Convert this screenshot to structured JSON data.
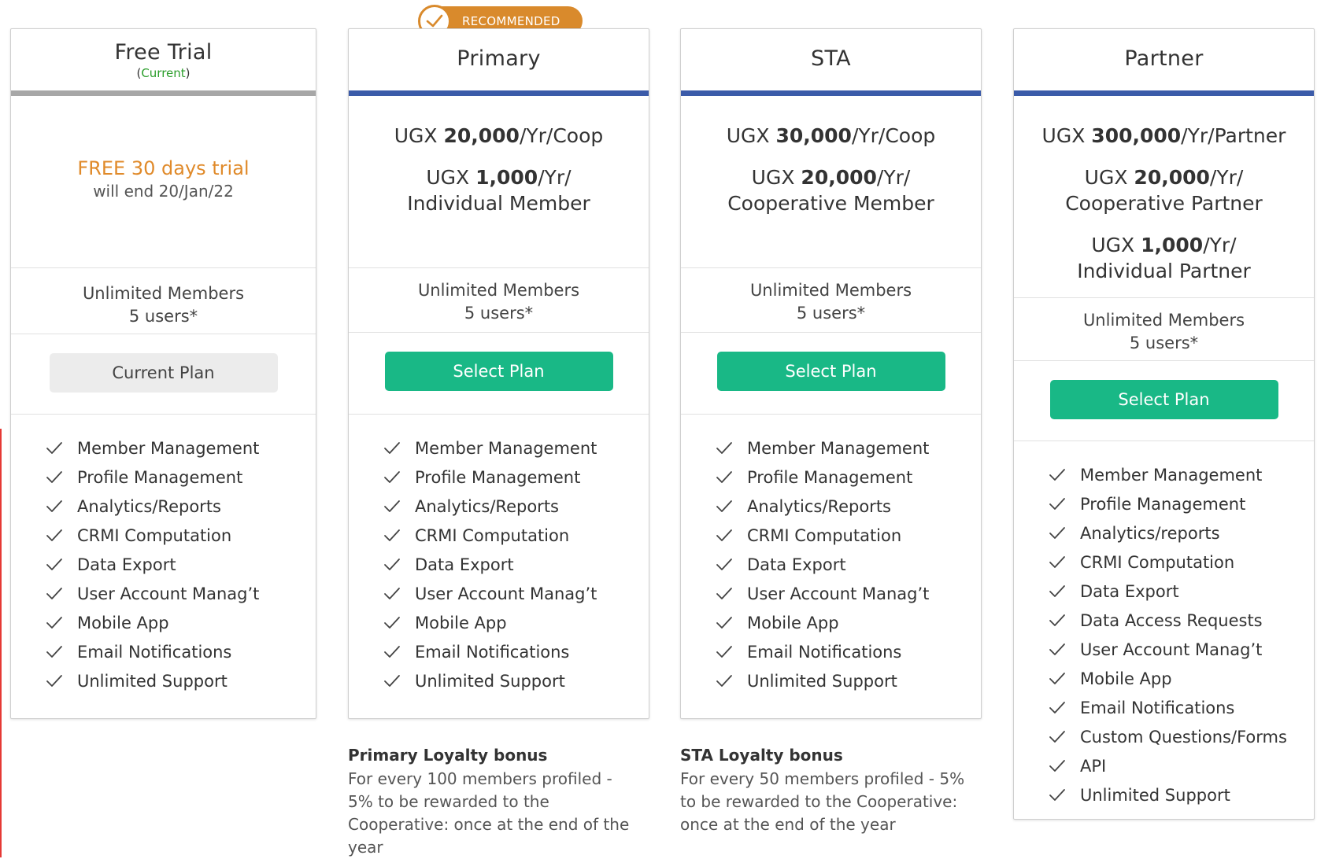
{
  "badge": {
    "label": "RECOMMENDED",
    "color": "#d98a2c"
  },
  "colors": {
    "accent": "#3b5ba9",
    "button": "#19b886",
    "free_accent": "#e08a2a",
    "current_green": "#2a9d2a"
  },
  "plans": [
    {
      "title": "Free Trial",
      "current_prefix": "(",
      "current_label": "Current",
      "current_suffix": ")",
      "free_title": "FREE 30 days trial",
      "free_sub": "will end 20/Jan/22",
      "members": "Unlimited Members",
      "users": "5 users*",
      "button": "Current Plan",
      "features": [
        "Member Management",
        "Profile Management",
        "Analytics/Reports",
        "CRMI Computation",
        "Data Export",
        "User Account Manag’t",
        "Mobile App",
        "Email Notifications",
        "Unlimited Support"
      ]
    },
    {
      "title": "Primary",
      "prices": [
        {
          "prefix": "UGX ",
          "amount": "20,000",
          "suffix": "/Yr/Coop",
          "line2": ""
        },
        {
          "prefix": "UGX ",
          "amount": "1,000",
          "suffix": "/Yr/",
          "line2": "Individual Member"
        }
      ],
      "members": "Unlimited Members",
      "users": "5 users*",
      "button": "Select Plan",
      "features": [
        "Member Management",
        "Profile Management",
        "Analytics/Reports",
        "CRMI Computation",
        "Data Export",
        "User Account Manag’t",
        "Mobile App",
        "Email Notifications",
        "Unlimited Support"
      ],
      "bonus_title": "Primary Loyalty bonus",
      "bonus_text": "For every 100 members profiled - 5% to be rewarded to the Cooperative: once at the end of the year"
    },
    {
      "title": "STA",
      "prices": [
        {
          "prefix": "UGX ",
          "amount": "30,000",
          "suffix": "/Yr/Coop",
          "line2": ""
        },
        {
          "prefix": "UGX ",
          "amount": "20,000",
          "suffix": "/Yr/",
          "line2": "Cooperative Member"
        }
      ],
      "members": "Unlimited Members",
      "users": "5 users*",
      "button": "Select Plan",
      "features": [
        "Member Management",
        "Profile Management",
        "Analytics/Reports",
        "CRMI Computation",
        "Data Export",
        "User Account Manag’t",
        "Mobile App",
        "Email Notifications",
        "Unlimited Support"
      ],
      "bonus_title": "STA Loyalty bonus",
      "bonus_text": "For every 50 members profiled - 5% to be rewarded to the Cooperative: once at the end of the year"
    },
    {
      "title": "Partner",
      "prices": [
        {
          "prefix": "UGX ",
          "amount": "300,000",
          "suffix": "/Yr/Partner",
          "line2": ""
        },
        {
          "prefix": "UGX ",
          "amount": "20,000",
          "suffix": "/Yr/",
          "line2": "Cooperative Partner"
        },
        {
          "prefix": "UGX ",
          "amount": "1,000",
          "suffix": "/Yr/",
          "line2": "Individual Partner"
        }
      ],
      "members": "Unlimited Members",
      "users": "5 users*",
      "button": "Select Plan",
      "features": [
        "Member Management",
        "Profile Management",
        "Analytics/reports",
        "CRMI Computation",
        "Data Export",
        "Data Access Requests",
        "User Account Manag’t",
        "Mobile App",
        "Email Notifications",
        "Custom Questions/Forms",
        "API",
        "Unlimited Support"
      ]
    }
  ]
}
